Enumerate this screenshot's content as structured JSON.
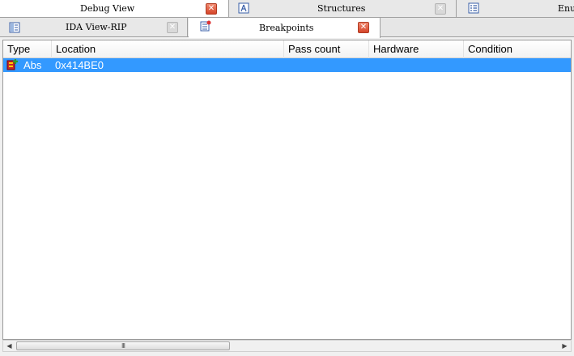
{
  "tabs_top": [
    {
      "label": "Debug View",
      "icon": "debug-view-icon",
      "close": "red"
    },
    {
      "label": "Structures",
      "icon": "structures-icon",
      "close": "grey"
    },
    {
      "label": "Enu",
      "icon": "enums-icon"
    }
  ],
  "tabs_second": [
    {
      "label": "IDA View-RIP",
      "icon": "ida-view-icon",
      "close": "grey"
    },
    {
      "label": "Breakpoints",
      "icon": "breakpoints-icon",
      "close": "red",
      "active": true
    }
  ],
  "close_glyph": "✕",
  "columns": [
    "Type",
    "Location",
    "Pass count",
    "Hardware",
    "Condition"
  ],
  "rows": [
    {
      "type": "Abs",
      "location": "0x414BE0",
      "pass_count": "",
      "hardware": "",
      "condition": "",
      "icon": "breakpoint-icon"
    }
  ],
  "scrollbar": {
    "left_arrow": "◀",
    "right_arrow": "▶",
    "grip": "III"
  },
  "colors": {
    "selection": "#3399ff",
    "close_active": "#d5452a"
  }
}
